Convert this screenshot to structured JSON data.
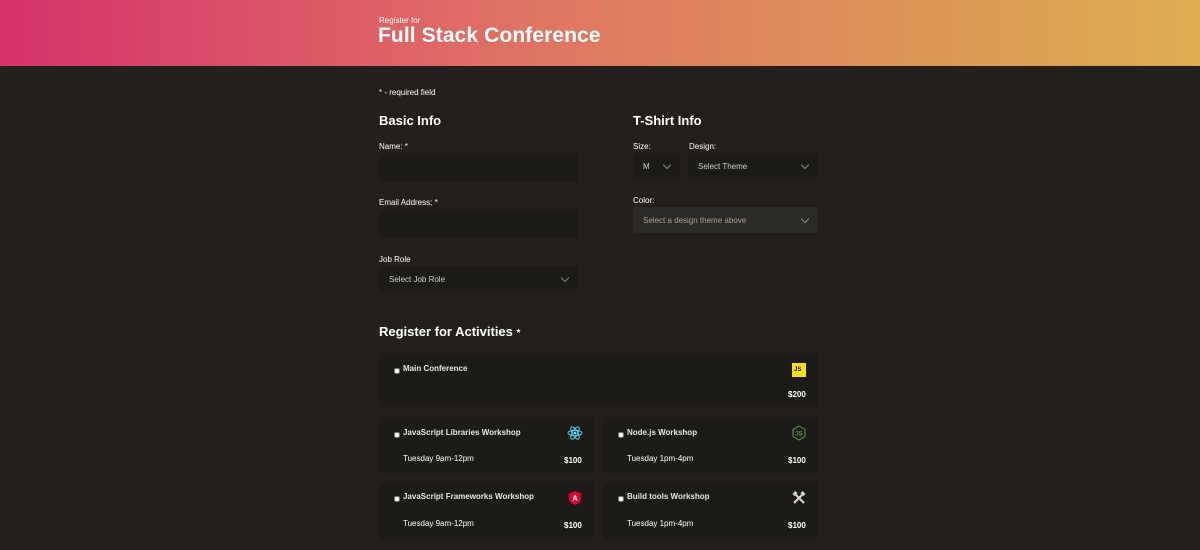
{
  "header": {
    "kicker": "Register for",
    "title": "Full Stack Conference",
    "gradient_colors": [
      "#d6336c",
      "#df7563",
      "#dcae4d"
    ]
  },
  "required_note": "* - required field",
  "basic_info": {
    "heading": "Basic Info",
    "name_label": "Name: *",
    "name_value": "",
    "email_label": "Email Address: *",
    "email_value": "",
    "job_role_label": "Job Role",
    "job_role_selected": "Select Job Role"
  },
  "tshirt_info": {
    "heading": "T-Shirt Info",
    "size_label": "Size:",
    "size_selected": "M",
    "design_label": "Design:",
    "design_selected": "Select Theme",
    "color_label": "Color:",
    "color_selected": "Select a design theme above"
  },
  "activities": {
    "heading": "Register for Activities",
    "required_marker": "*",
    "items": [
      {
        "name": "Main Conference",
        "time": "",
        "cost": "$200",
        "icon": "javascript-icon",
        "checked": false
      },
      {
        "name": "JavaScript Libraries Workshop",
        "time": "Tuesday 9am-12pm",
        "cost": "$100",
        "icon": "react-icon",
        "checked": false
      },
      {
        "name": "Node.js Workshop",
        "time": "Tuesday 1pm-4pm",
        "cost": "$100",
        "icon": "nodejs-icon",
        "checked": false
      },
      {
        "name": "JavaScript Frameworks Workshop",
        "time": "Tuesday 9am-12pm",
        "cost": "$100",
        "icon": "angular-icon",
        "checked": false
      },
      {
        "name": "Build tools Workshop",
        "time": "Tuesday 1pm-4pm",
        "cost": "$100",
        "icon": "tools-icon",
        "checked": false
      }
    ]
  }
}
